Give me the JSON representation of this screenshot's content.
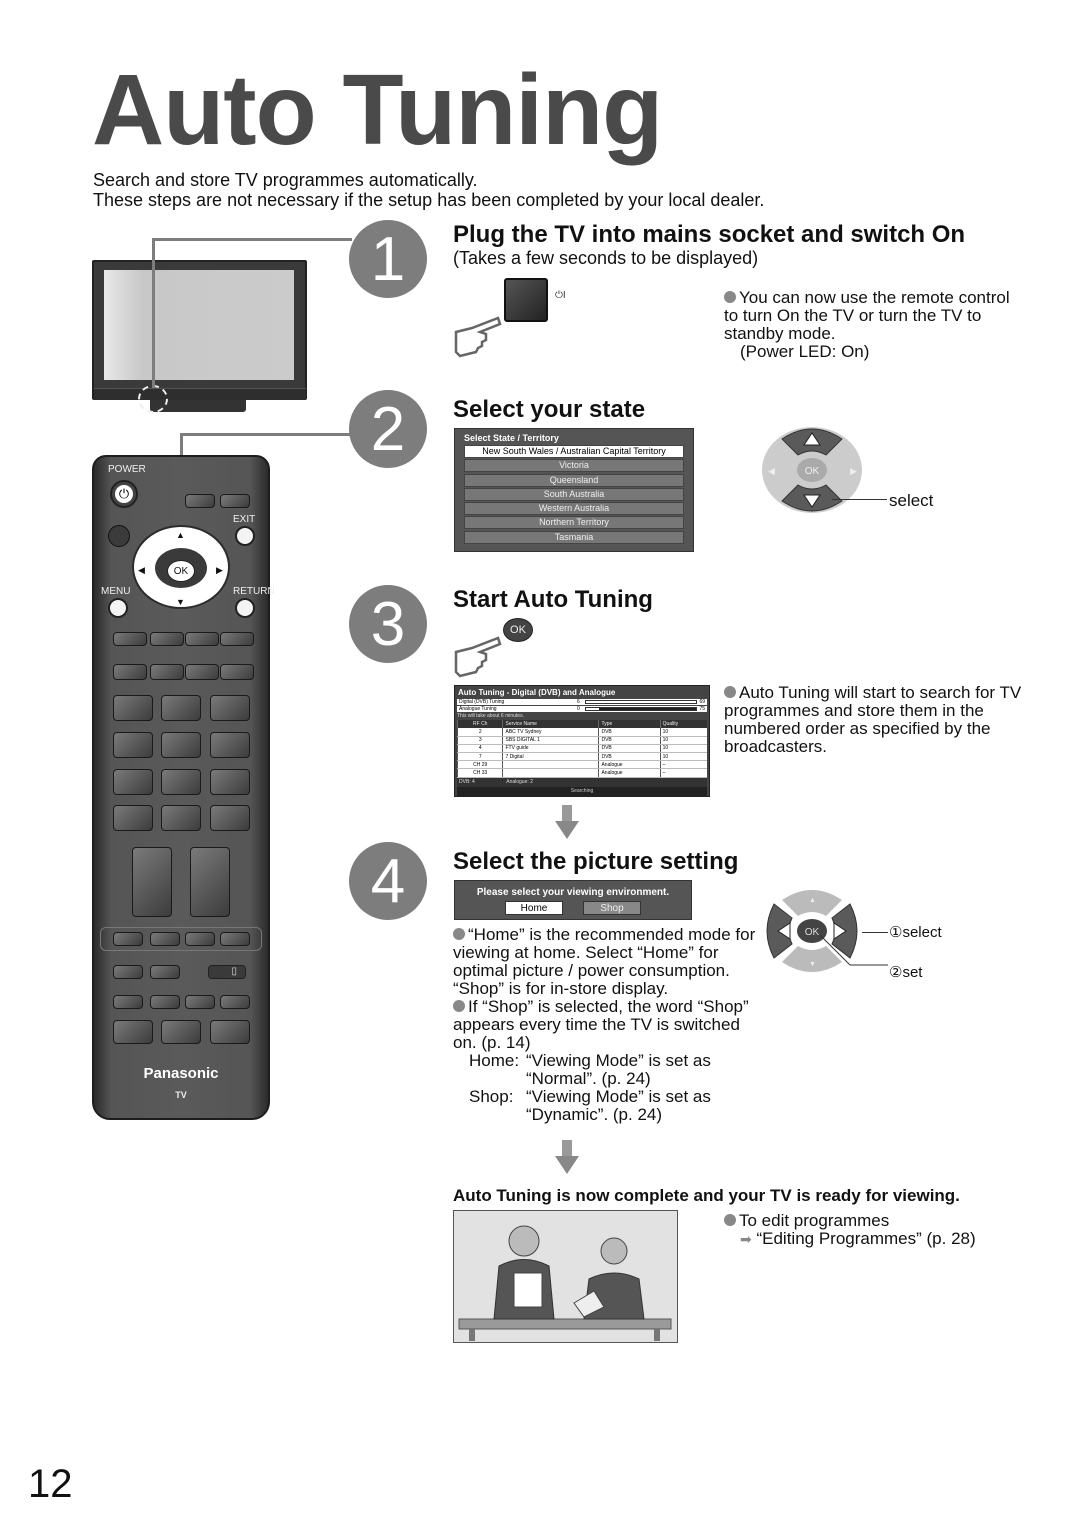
{
  "page": {
    "title": "Auto Tuning",
    "intro": [
      "Search and store TV programmes automatically.",
      "These steps are not necessary if the setup has been completed by your local dealer."
    ],
    "page_number": "12"
  },
  "steps": [
    {
      "number": "1",
      "heading": "Plug the TV into mains socket and switch On",
      "subtext": "(Takes a few seconds to be displayed)",
      "power_symbol": "⏻I",
      "notes": [
        "You can now use the remote control to turn On the TV or turn the TV to standby mode.",
        "(Power LED: On)"
      ]
    },
    {
      "number": "2",
      "heading": "Select your state",
      "panel": {
        "title": "Select State / Territory",
        "items": [
          "New South Wales / Australian Capital Territory",
          "Victoria",
          "Queensland",
          "South Australia",
          "Western Australia",
          "Northern Territory",
          "Tasmania"
        ],
        "selected_index": 0
      },
      "dpad_ok_label": "OK",
      "callout": "select"
    },
    {
      "number": "3",
      "heading": "Start Auto Tuning",
      "ok_label": "OK",
      "panel": {
        "title": "Auto Tuning - Digital (DVB) and Analogue",
        "digital_label": "Digital (DVB) Tuning",
        "digital_start": "6",
        "digital_end": "69",
        "digital_progress": 1.0,
        "analogue_label": "Analogue Tuning",
        "analogue_start": "0",
        "analogue_end": "75",
        "analogue_progress": 0.12,
        "note": "This will take about 6 minutes.",
        "columns": [
          "RF Ch",
          "Service Name",
          "Type",
          "Quality"
        ],
        "rows": [
          [
            "2",
            "ABC TV Sydney",
            "DVB",
            "10"
          ],
          [
            "3",
            "SBS DIGITAL 1",
            "DVB",
            "10"
          ],
          [
            "4",
            "FTV guide",
            "DVB",
            "10"
          ],
          [
            "7",
            "7 Digital",
            "DVB",
            "10"
          ],
          [
            "CH 29",
            "",
            "Analogue",
            "–"
          ],
          [
            "CH 33",
            "",
            "Analogue",
            "–"
          ]
        ],
        "footer_dvb": "DVB: 4",
        "footer_analogue": "Analogue: 2",
        "status": "Searching"
      },
      "notes": [
        "Auto Tuning will start to search for TV programmes and store them in the numbered order as specified by the broadcasters."
      ]
    },
    {
      "number": "4",
      "heading": "Select the picture setting",
      "panel": {
        "title": "Please select your viewing environment.",
        "options": [
          "Home",
          "Shop"
        ],
        "selected_index": 0
      },
      "dpad_ok_label": "OK",
      "callouts": [
        "①select",
        "②set"
      ],
      "notes": [
        "“Home” is the recommended mode for viewing at home. Select “Home” for optimal picture / power consumption. “Shop” is for in-store display.",
        "If “Shop” is selected, the word “Shop” appears every time the TV is switched on. (p. 14)"
      ],
      "modes": [
        {
          "label": "Home:",
          "text": "“Viewing Mode” is set as",
          "text2": "“Normal”. (p. 24)"
        },
        {
          "label": "Shop:",
          "text": "“Viewing Mode” is set as",
          "text2": "“Dynamic”. (p. 24)"
        }
      ]
    }
  ],
  "final": {
    "heading": "Auto Tuning is now complete and your TV is ready for viewing.",
    "note": "To edit programmes",
    "link": "“Editing Programmes” (p. 28)"
  },
  "remote": {
    "power_label": "POWER",
    "exit_label": "EXIT",
    "menu_label": "MENU",
    "return_label": "RETURN",
    "ok_label": "OK",
    "brand": "Panasonic",
    "brand_sub": "TV"
  },
  "colors": {
    "title_gray": "#4a4a4a",
    "step_circle": "#7d7d7d",
    "panel_bg": "#555555"
  }
}
